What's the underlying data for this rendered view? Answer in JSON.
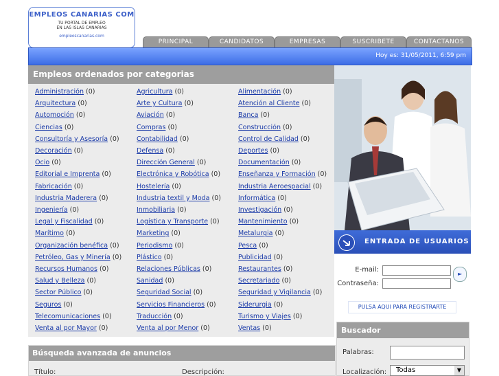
{
  "logo": {
    "title": "EMPLEOS CANARIAS COM",
    "tagline_1": "TU PORTAL DE EMPLEO",
    "tagline_2": "EN LAS ISLAS CANARIAS",
    "url": "empleoscanarias.com"
  },
  "nav": {
    "tabs": [
      "PRINCIPAL",
      "CANDIDATOS",
      "EMPRESAS",
      "SUSCRIBETE",
      "CONTACTANOS"
    ]
  },
  "header_bar": {
    "date_text": "Hoy es: 31/05/2011, 6:59 pm"
  },
  "categories_panel": {
    "title": "Empleos ordenados por categorias",
    "columns": [
      [
        {
          "name": "Administración",
          "count": "(0)"
        },
        {
          "name": "Arquitectura",
          "count": "(0)"
        },
        {
          "name": "Automoción",
          "count": "(0)"
        },
        {
          "name": "Ciencias",
          "count": "(0)"
        },
        {
          "name": "Consultoría y Asesoría",
          "count": "(0)"
        },
        {
          "name": "Decoración",
          "count": "(0)"
        },
        {
          "name": "Ocio",
          "count": "(0)"
        },
        {
          "name": "Editorial e Imprenta",
          "count": "(0)"
        },
        {
          "name": "Fabricación",
          "count": "(0)"
        },
        {
          "name": "Industria Maderera",
          "count": "(0)"
        },
        {
          "name": "Ingeniería",
          "count": "(0)"
        },
        {
          "name": "Legal y Fiscalidad",
          "count": "(0)"
        },
        {
          "name": "Marítimo",
          "count": "(0)"
        },
        {
          "name": "Organización benéfica",
          "count": "(0)"
        },
        {
          "name": "Petróleo, Gas y Minería",
          "count": "(0)"
        },
        {
          "name": "Recursos Humanos",
          "count": "(0)"
        },
        {
          "name": "Salud y Belleza",
          "count": "(0)"
        },
        {
          "name": "Sector Público",
          "count": "(0)"
        },
        {
          "name": "Seguros",
          "count": "(0)"
        },
        {
          "name": "Telecomunicaciones",
          "count": "(0)"
        },
        {
          "name": "Venta al por Mayor",
          "count": "(0)"
        }
      ],
      [
        {
          "name": "Agricultura",
          "count": "(0)"
        },
        {
          "name": "Arte y Cultura",
          "count": "(0)"
        },
        {
          "name": "Aviación",
          "count": "(0)"
        },
        {
          "name": "Compras",
          "count": "(0)"
        },
        {
          "name": "Contabilidad",
          "count": "(0)"
        },
        {
          "name": "Defensa",
          "count": "(0)"
        },
        {
          "name": "Dirección General",
          "count": "(0)"
        },
        {
          "name": "Electrónica y Robótica",
          "count": "(0)"
        },
        {
          "name": "Hostelería",
          "count": "(0)"
        },
        {
          "name": "Industria textil y Moda",
          "count": "(0)"
        },
        {
          "name": "Inmobiliaria",
          "count": "(0)"
        },
        {
          "name": "Logística y Transporte",
          "count": "(0)"
        },
        {
          "name": "Marketing",
          "count": "(0)"
        },
        {
          "name": "Periodismo",
          "count": "(0)"
        },
        {
          "name": "Plástico",
          "count": "(0)"
        },
        {
          "name": "Relaciones Públicas",
          "count": "(0)"
        },
        {
          "name": "Sanidad",
          "count": "(0)"
        },
        {
          "name": "Seguridad Social",
          "count": "(0)"
        },
        {
          "name": "Servicios Financieros",
          "count": "(0)"
        },
        {
          "name": "Traducción",
          "count": "(0)"
        },
        {
          "name": "Venta al por Menor",
          "count": "(0)"
        }
      ],
      [
        {
          "name": "Alimentación",
          "count": "(0)"
        },
        {
          "name": "Atención al Cliente",
          "count": "(0)"
        },
        {
          "name": "Banca",
          "count": "(0)"
        },
        {
          "name": "Construcción",
          "count": "(0)"
        },
        {
          "name": "Control de Calidad",
          "count": "(0)"
        },
        {
          "name": "Deportes",
          "count": "(0)"
        },
        {
          "name": "Documentación",
          "count": "(0)"
        },
        {
          "name": "Enseñanza y Formación",
          "count": "(0)"
        },
        {
          "name": "Industria Aeroespacial",
          "count": "(0)"
        },
        {
          "name": "Informática",
          "count": "(0)"
        },
        {
          "name": "Investigación",
          "count": "(0)"
        },
        {
          "name": "Mantenimiento",
          "count": "(0)"
        },
        {
          "name": "Metalurgia",
          "count": "(0)"
        },
        {
          "name": "Pesca",
          "count": "(0)"
        },
        {
          "name": "Publicidad",
          "count": "(0)"
        },
        {
          "name": "Restaurantes",
          "count": "(0)"
        },
        {
          "name": "Secretariado",
          "count": "(0)"
        },
        {
          "name": "Seguridad y Vigilancia",
          "count": "(0)"
        },
        {
          "name": "Siderurgia",
          "count": "(0)"
        },
        {
          "name": "Turismo y Viajes",
          "count": "(0)"
        },
        {
          "name": "Ventas",
          "count": "(0)"
        }
      ]
    ]
  },
  "login": {
    "banner_text": "ENTRADA DE USUARIOS",
    "email_label": "E-mail:",
    "password_label": "Contraseña:",
    "register_text": "PULSA AQUI PARA REGISTRARTE"
  },
  "search": {
    "title": "Buscador",
    "words_label": "Palabras:",
    "location_label": "Localización:",
    "location_value": "Todas"
  },
  "advanced": {
    "title": "Búsqueda avanzada de anuncios",
    "title_label": "Título:",
    "description_label": "Descripción:"
  },
  "colors": {
    "accent_blue": "#3c6de6",
    "panel_header_gray": "#9e9e9e",
    "link_blue": "#1a3aa8"
  }
}
